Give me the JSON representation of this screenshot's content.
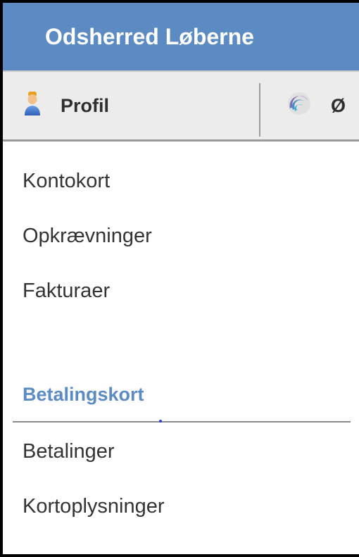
{
  "header": {
    "title": "Odsherred Løberne"
  },
  "tabs": [
    {
      "label": "Profil",
      "icon": "user-icon"
    },
    {
      "label": "Ø",
      "icon": "swirl-icon"
    }
  ],
  "menu": {
    "items": [
      {
        "label": "Kontokort"
      },
      {
        "label": "Opkrævninger"
      },
      {
        "label": "Fakturaer"
      }
    ],
    "section": {
      "heading": "Betalingskort",
      "items": [
        {
          "label": "Betalinger"
        },
        {
          "label": "Kortoplysninger"
        }
      ]
    }
  },
  "colors": {
    "header_bg": "#5c8bc4",
    "header_text": "#ffffff",
    "section_heading": "#5c8bc4",
    "tab_bar_bg": "#ececec"
  }
}
